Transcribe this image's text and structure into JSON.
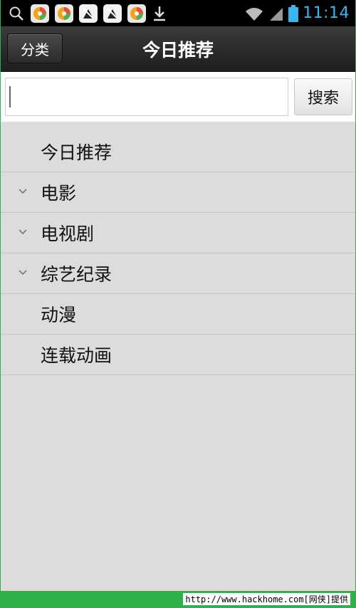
{
  "status_bar": {
    "time": "11:14",
    "icons": [
      "search-icon",
      "app-360-icon",
      "app-360-icon",
      "usb-debug-icon",
      "usb-debug-icon",
      "app-360-icon",
      "download-icon",
      "wifi-icon",
      "signal-icon",
      "battery-icon"
    ],
    "clock_color": "#35b8f0"
  },
  "header": {
    "category_button": "分类",
    "title": "今日推荐"
  },
  "search": {
    "value": "",
    "button_label": "搜索"
  },
  "categories": [
    {
      "label": "今日推荐",
      "expandable": false
    },
    {
      "label": "电影",
      "expandable": true
    },
    {
      "label": "电视剧",
      "expandable": true
    },
    {
      "label": "综艺纪录",
      "expandable": true
    },
    {
      "label": "动漫",
      "expandable": false
    },
    {
      "label": "连载动画",
      "expandable": false
    }
  ],
  "watermark": "http://www.hackhome.com[网侠]提供"
}
